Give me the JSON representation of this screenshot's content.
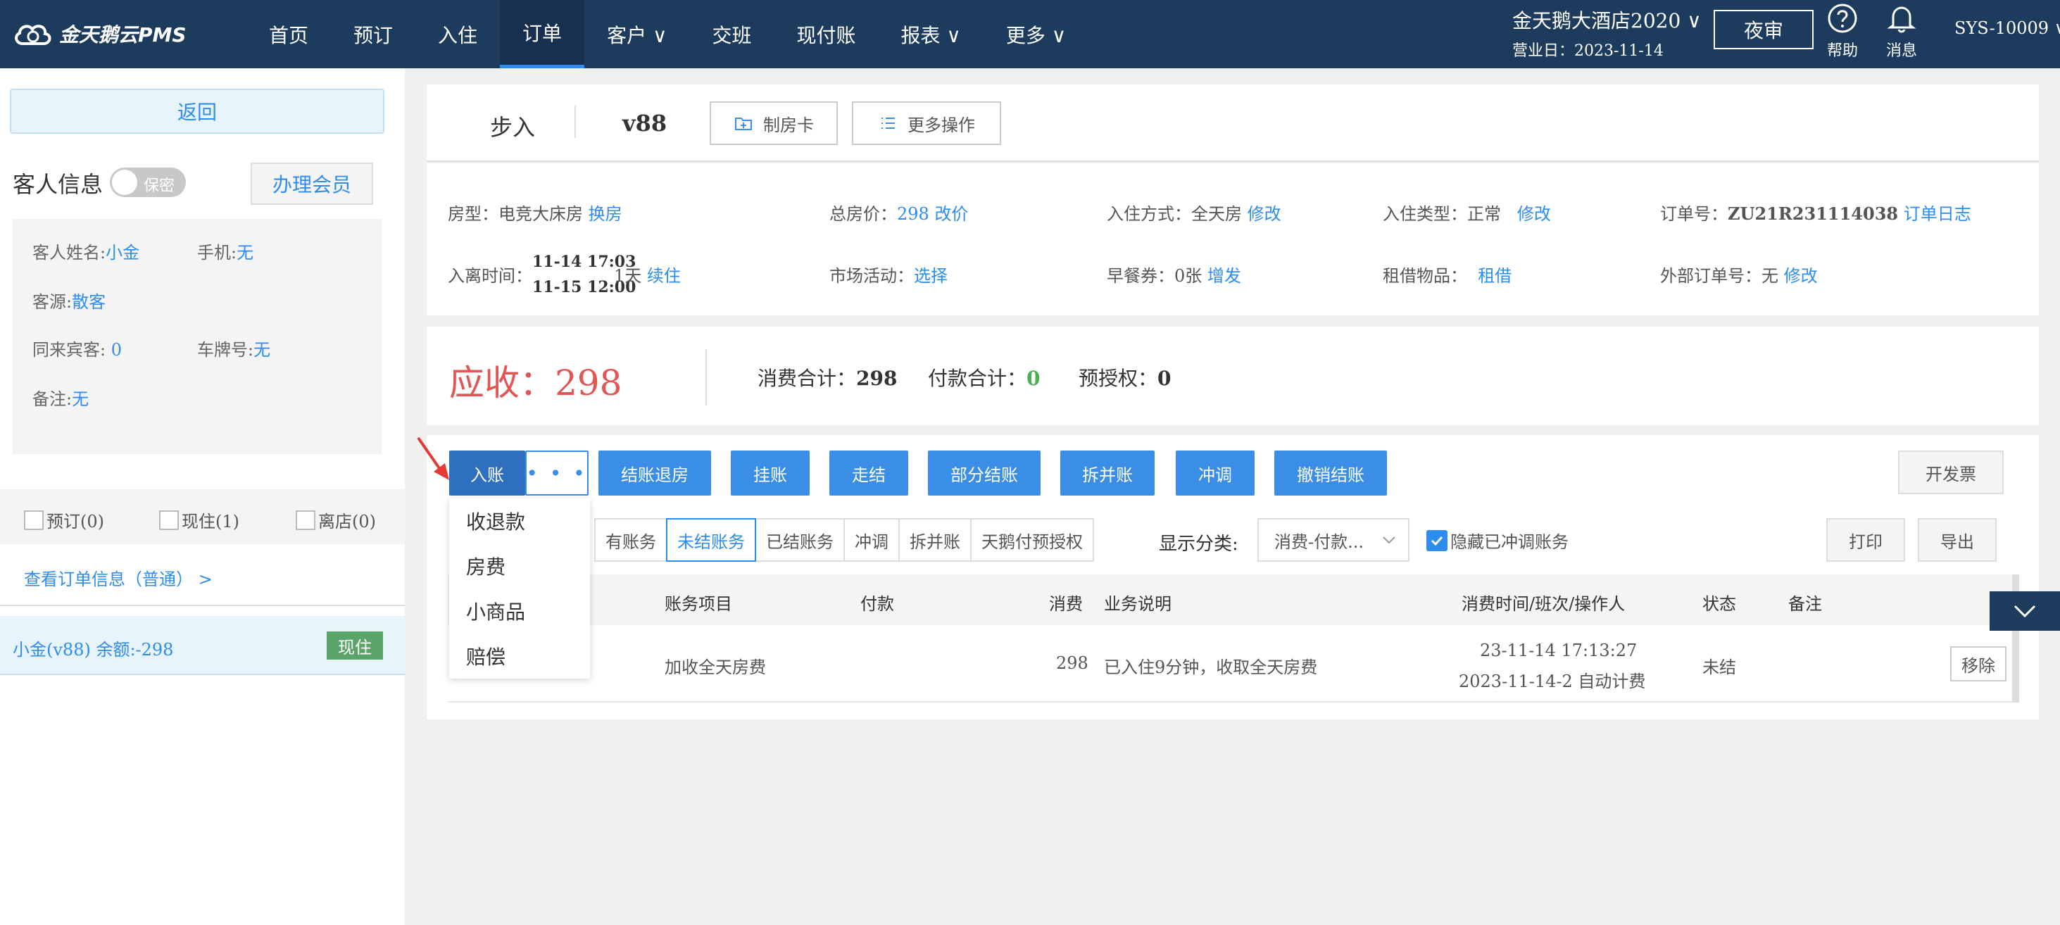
{
  "header": {
    "logo_text": "金天鹅云PMS",
    "nav": [
      {
        "label": "首页"
      },
      {
        "label": "预订"
      },
      {
        "label": "入住"
      },
      {
        "label": "订单",
        "active": true
      },
      {
        "label": "客户 ∨"
      },
      {
        "label": "交班"
      },
      {
        "label": "现付账"
      },
      {
        "label": "报表 ∨"
      },
      {
        "label": "更多 ∨"
      }
    ],
    "hotel_name": "金天鹅大酒店2020 ∨",
    "business_date": "营业日：2023-11-14",
    "night_audit": "夜审",
    "help_label": "帮助",
    "message_label": "消息",
    "user": "SYS-10009 ∨"
  },
  "left": {
    "back_label": "返回",
    "guest_info_title": "客人信息",
    "privacy_toggle": "保密",
    "member_button": "办理会员",
    "guest_name_label": "客人姓名:",
    "guest_name_value": "小金",
    "phone_label": "手机:",
    "phone_value": "无",
    "source_label": "客源:",
    "source_value": "散客",
    "companions_label": "同来宾客:",
    "companions_value": "0",
    "plate_label": "车牌号:",
    "plate_value": "无",
    "remark_label": "备注:",
    "remark_value": "无",
    "filter_reserved": "预订(0)",
    "filter_inhouse": "现住(1)",
    "filter_checkedout": "离店(0)",
    "order_info_link": "查看订单信息（普通） >",
    "guest_row_text": "小金(v88)   余额:-298",
    "guest_row_badge": "现住"
  },
  "order": {
    "walkin": "步入",
    "room_no": "v88",
    "make_card": "制房卡",
    "more_ops": "更多操作"
  },
  "details": {
    "room_type_label": "房型：电竞大床房",
    "change_room": "换房",
    "total_price_label": "总房价：",
    "total_price_value": "298 改价",
    "checkin_method_label": "入住方式：全天房",
    "checkin_method_edit": "修改",
    "checkin_type_label": "入住类型：正常",
    "checkin_type_edit": "修改",
    "order_no_label": "订单号：",
    "order_no_value": "ZU21R231114038",
    "order_log": "订单日志",
    "dates_label": "入离时间：",
    "date_in": "11-14 17:03",
    "date_out": "11-15 12:00",
    "nights": "1天",
    "extend": "续住",
    "market_label": "市场活动：",
    "market_select": "选择",
    "breakfast_label": "早餐券：0张",
    "breakfast_add": "增发",
    "rental_label": "租借物品：",
    "rental_link": "租借",
    "external_no_label": "外部订单号：无",
    "external_no_edit": "修改"
  },
  "summary": {
    "receivable": "应收：298",
    "consumption_label": "消费合计：",
    "consumption_value": "298",
    "payment_label": "付款合计：",
    "payment_value": "0",
    "preauth_label": "预授权：",
    "preauth_value": "0"
  },
  "actions": {
    "post": "入账",
    "more": "• • •",
    "checkout": "结账退房",
    "hang": "挂账",
    "walk": "走结",
    "partial": "部分结账",
    "split_merge": "拆并账",
    "adjust": "冲调",
    "undo_checkout": "撤销结账",
    "invoice": "开发票",
    "print": "打印",
    "export": "导出"
  },
  "tabs": [
    {
      "label": "有账务"
    },
    {
      "label": "未结账务",
      "active": true
    },
    {
      "label": "已结账务"
    },
    {
      "label": "冲调"
    },
    {
      "label": "拆并账"
    },
    {
      "label": "天鹅付预授权"
    }
  ],
  "display_class_label": "显示分类:",
  "display_class_value": "消费-付款...",
  "hide_adjusted_label": "隐藏已冲调账务",
  "table": {
    "headers": [
      "账务项目",
      "付款",
      "消费",
      "业务说明",
      "消费时间/班次/操作人",
      "状态",
      "备注"
    ],
    "rows": [
      {
        "item": "加收全天房费",
        "payment": "",
        "consumption": "298",
        "description": "已入住9分钟，收取全天房费",
        "time": "23-11-14 17:13:27",
        "shift": "2023-11-14-2 自动计费",
        "status": "未结",
        "remark": "",
        "action": "移除"
      }
    ]
  },
  "dropdown": [
    "收退款",
    "房费",
    "小商品",
    "赔偿"
  ],
  "colors": {
    "header_bg": "#1d3b5c",
    "accent": "#3a8ee6",
    "receivable": "#e35454",
    "inhouse_badge": "#5aa469"
  }
}
